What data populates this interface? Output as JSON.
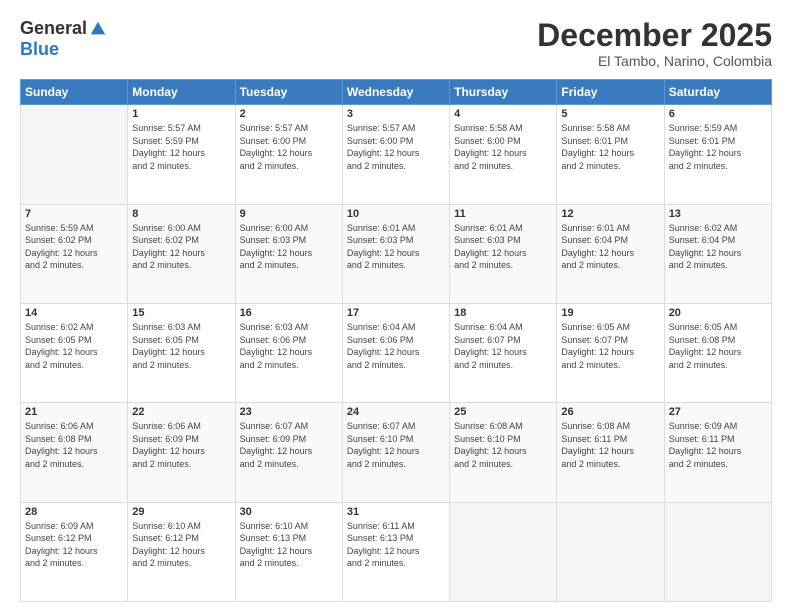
{
  "logo": {
    "general": "General",
    "blue": "Blue"
  },
  "header": {
    "title": "December 2025",
    "subtitle": "El Tambo, Narino, Colombia"
  },
  "weekdays": [
    "Sunday",
    "Monday",
    "Tuesday",
    "Wednesday",
    "Thursday",
    "Friday",
    "Saturday"
  ],
  "weeks": [
    [
      {
        "day": "",
        "info": ""
      },
      {
        "day": "1",
        "info": "Sunrise: 5:57 AM\nSunset: 5:59 PM\nDaylight: 12 hours\nand 2 minutes."
      },
      {
        "day": "2",
        "info": "Sunrise: 5:57 AM\nSunset: 6:00 PM\nDaylight: 12 hours\nand 2 minutes."
      },
      {
        "day": "3",
        "info": "Sunrise: 5:57 AM\nSunset: 6:00 PM\nDaylight: 12 hours\nand 2 minutes."
      },
      {
        "day": "4",
        "info": "Sunrise: 5:58 AM\nSunset: 6:00 PM\nDaylight: 12 hours\nand 2 minutes."
      },
      {
        "day": "5",
        "info": "Sunrise: 5:58 AM\nSunset: 6:01 PM\nDaylight: 12 hours\nand 2 minutes."
      },
      {
        "day": "6",
        "info": "Sunrise: 5:59 AM\nSunset: 6:01 PM\nDaylight: 12 hours\nand 2 minutes."
      }
    ],
    [
      {
        "day": "7",
        "info": "Sunrise: 5:59 AM\nSunset: 6:02 PM\nDaylight: 12 hours\nand 2 minutes."
      },
      {
        "day": "8",
        "info": "Sunrise: 6:00 AM\nSunset: 6:02 PM\nDaylight: 12 hours\nand 2 minutes."
      },
      {
        "day": "9",
        "info": "Sunrise: 6:00 AM\nSunset: 6:03 PM\nDaylight: 12 hours\nand 2 minutes."
      },
      {
        "day": "10",
        "info": "Sunrise: 6:01 AM\nSunset: 6:03 PM\nDaylight: 12 hours\nand 2 minutes."
      },
      {
        "day": "11",
        "info": "Sunrise: 6:01 AM\nSunset: 6:03 PM\nDaylight: 12 hours\nand 2 minutes."
      },
      {
        "day": "12",
        "info": "Sunrise: 6:01 AM\nSunset: 6:04 PM\nDaylight: 12 hours\nand 2 minutes."
      },
      {
        "day": "13",
        "info": "Sunrise: 6:02 AM\nSunset: 6:04 PM\nDaylight: 12 hours\nand 2 minutes."
      }
    ],
    [
      {
        "day": "14",
        "info": "Sunrise: 6:02 AM\nSunset: 6:05 PM\nDaylight: 12 hours\nand 2 minutes."
      },
      {
        "day": "15",
        "info": "Sunrise: 6:03 AM\nSunset: 6:05 PM\nDaylight: 12 hours\nand 2 minutes."
      },
      {
        "day": "16",
        "info": "Sunrise: 6:03 AM\nSunset: 6:06 PM\nDaylight: 12 hours\nand 2 minutes."
      },
      {
        "day": "17",
        "info": "Sunrise: 6:04 AM\nSunset: 6:06 PM\nDaylight: 12 hours\nand 2 minutes."
      },
      {
        "day": "18",
        "info": "Sunrise: 6:04 AM\nSunset: 6:07 PM\nDaylight: 12 hours\nand 2 minutes."
      },
      {
        "day": "19",
        "info": "Sunrise: 6:05 AM\nSunset: 6:07 PM\nDaylight: 12 hours\nand 2 minutes."
      },
      {
        "day": "20",
        "info": "Sunrise: 6:05 AM\nSunset: 6:08 PM\nDaylight: 12 hours\nand 2 minutes."
      }
    ],
    [
      {
        "day": "21",
        "info": "Sunrise: 6:06 AM\nSunset: 6:08 PM\nDaylight: 12 hours\nand 2 minutes."
      },
      {
        "day": "22",
        "info": "Sunrise: 6:06 AM\nSunset: 6:09 PM\nDaylight: 12 hours\nand 2 minutes."
      },
      {
        "day": "23",
        "info": "Sunrise: 6:07 AM\nSunset: 6:09 PM\nDaylight: 12 hours\nand 2 minutes."
      },
      {
        "day": "24",
        "info": "Sunrise: 6:07 AM\nSunset: 6:10 PM\nDaylight: 12 hours\nand 2 minutes."
      },
      {
        "day": "25",
        "info": "Sunrise: 6:08 AM\nSunset: 6:10 PM\nDaylight: 12 hours\nand 2 minutes."
      },
      {
        "day": "26",
        "info": "Sunrise: 6:08 AM\nSunset: 6:11 PM\nDaylight: 12 hours\nand 2 minutes."
      },
      {
        "day": "27",
        "info": "Sunrise: 6:09 AM\nSunset: 6:11 PM\nDaylight: 12 hours\nand 2 minutes."
      }
    ],
    [
      {
        "day": "28",
        "info": "Sunrise: 6:09 AM\nSunset: 6:12 PM\nDaylight: 12 hours\nand 2 minutes."
      },
      {
        "day": "29",
        "info": "Sunrise: 6:10 AM\nSunset: 6:12 PM\nDaylight: 12 hours\nand 2 minutes."
      },
      {
        "day": "30",
        "info": "Sunrise: 6:10 AM\nSunset: 6:13 PM\nDaylight: 12 hours\nand 2 minutes."
      },
      {
        "day": "31",
        "info": "Sunrise: 6:11 AM\nSunset: 6:13 PM\nDaylight: 12 hours\nand 2 minutes."
      },
      {
        "day": "",
        "info": ""
      },
      {
        "day": "",
        "info": ""
      },
      {
        "day": "",
        "info": ""
      }
    ]
  ]
}
